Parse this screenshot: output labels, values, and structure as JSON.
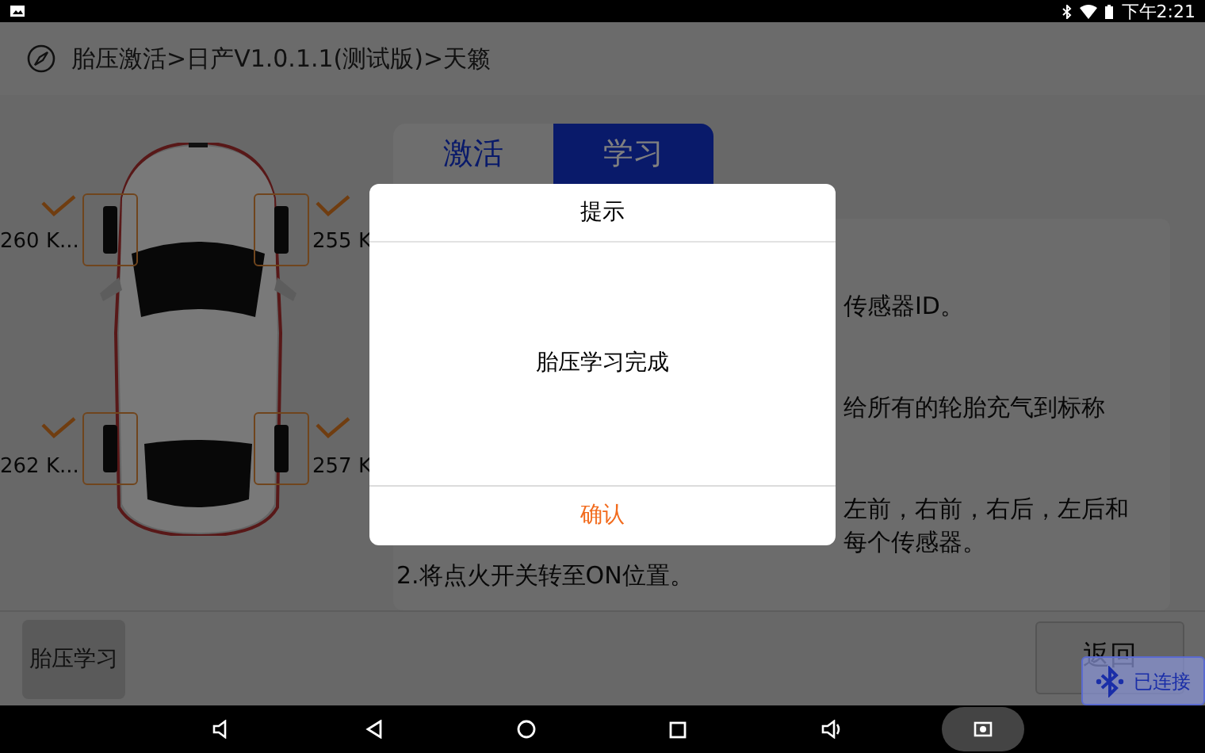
{
  "status_bar": {
    "time": "下午2:21"
  },
  "header": {
    "breadcrumb": "胎压激活>日产V1.0.1.1(测试版)>天籁"
  },
  "tabs": [
    {
      "label": "激活",
      "selected": false
    },
    {
      "label": "学习",
      "selected": true
    }
  ],
  "tires": [
    {
      "reading": "260 K...",
      "checked": true
    },
    {
      "reading": "255 K",
      "checked": true
    },
    {
      "reading": "262 K...",
      "checked": true
    },
    {
      "reading": "257 K",
      "checked": true
    }
  ],
  "instructions": [
    [
      "传感器ID。"
    ],
    [
      "给所有的轮胎充气到标称"
    ],
    [
      "左前，右前，右后，左后和",
      "每个传感器。",
      "2.将点火开关转至ON位置。"
    ]
  ],
  "buttons": {
    "left": "胎压学习",
    "right": "返回"
  },
  "connection_badge": {
    "label": "已连接"
  },
  "dialog": {
    "title": "提示",
    "message": "胎压学习完成",
    "button": "确认"
  }
}
